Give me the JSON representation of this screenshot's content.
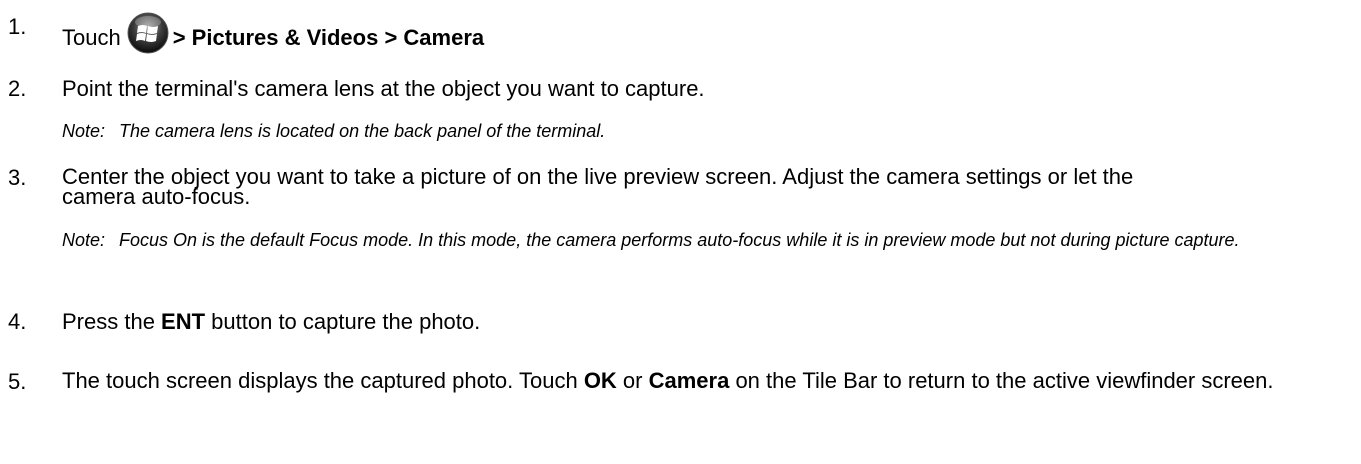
{
  "steps": [
    {
      "number": "1.",
      "parts": {
        "touch": "Touch",
        "icon": "windows-start-icon",
        "path": "> Pictures & Videos > Camera"
      }
    },
    {
      "number": "2.",
      "text": "Point the terminal's camera lens at the object you want to capture.",
      "note": {
        "label": "Note:",
        "text": "The camera lens is located on the back panel of the terminal."
      }
    },
    {
      "number": "3.",
      "text": "Center the object you want to take a picture of on the live preview screen. Adjust the camera settings or let the camera auto-focus.",
      "note": {
        "label": "Note:",
        "text": "Focus On is the default Focus mode. In this mode, the camera performs auto-focus while it is in preview mode but not during picture capture."
      }
    },
    {
      "number": "4.",
      "parts": {
        "before": "Press the ",
        "bold1": "ENT",
        "after": " button to capture the photo."
      }
    },
    {
      "number": "5.",
      "parts": {
        "before": "The touch screen displays the captured photo. Touch ",
        "bold1": "OK",
        "middle": " or ",
        "bold2": "Camera",
        "after": " on the Tile Bar to return to the active viewfinder screen."
      }
    }
  ]
}
